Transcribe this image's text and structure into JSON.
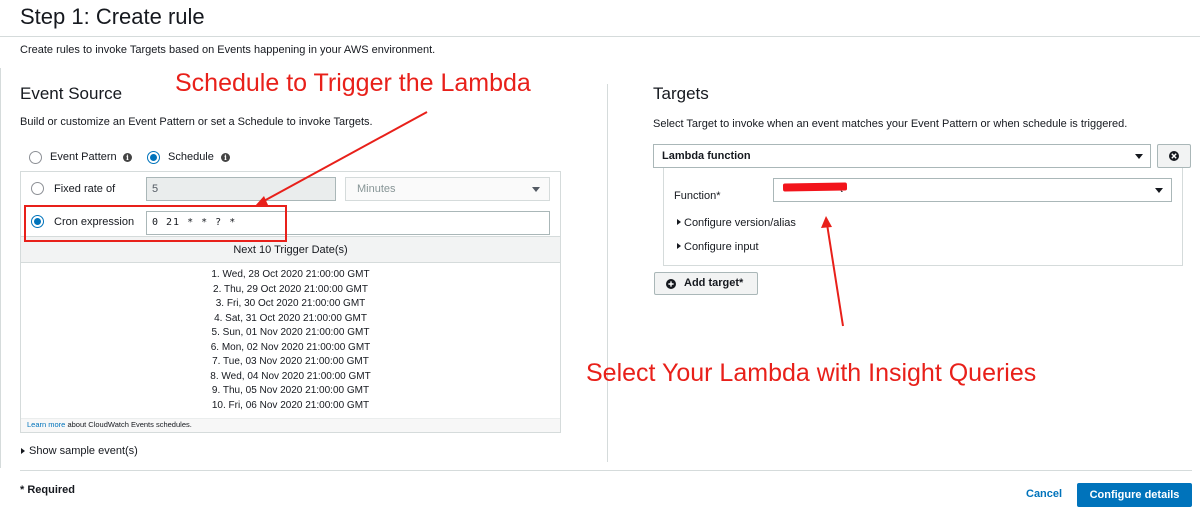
{
  "page": {
    "title": "Step 1: Create rule",
    "subtitle": "Create rules to invoke Targets based on Events happening in your AWS environment."
  },
  "event_source": {
    "heading": "Event Source",
    "help": "Build or customize an Event Pattern or set a Schedule to invoke Targets.",
    "mode_options": [
      {
        "label": "Event Pattern",
        "selected": false
      },
      {
        "label": "Schedule",
        "selected": true
      }
    ],
    "fixed_rate": {
      "label": "Fixed rate of",
      "value": "5",
      "unit": "Minutes",
      "selected": false
    },
    "cron": {
      "label": "Cron expression",
      "value": "0 21 * * ? *",
      "selected": true
    },
    "next_dates_header": "Next 10 Trigger Date(s)",
    "next_dates": [
      "1. Wed, 28 Oct 2020 21:00:00 GMT",
      "2. Thu, 29 Oct 2020 21:00:00 GMT",
      "3. Fri, 30 Oct 2020 21:00:00 GMT",
      "4. Sat, 31 Oct 2020 21:00:00 GMT",
      "5. Sun, 01 Nov 2020 21:00:00 GMT",
      "6. Mon, 02 Nov 2020 21:00:00 GMT",
      "7. Tue, 03 Nov 2020 21:00:00 GMT",
      "8. Wed, 04 Nov 2020 21:00:00 GMT",
      "9. Thu, 05 Nov 2020 21:00:00 GMT",
      "10. Fri, 06 Nov 2020 21:00:00 GMT"
    ],
    "learn_more_link": "Learn more",
    "learn_more_rest": " about CloudWatch Events schedules.",
    "show_sample": "Show sample event(s)"
  },
  "targets": {
    "heading": "Targets",
    "help": "Select Target to invoke when an event matches your Event Pattern or when schedule is triggered.",
    "target_type": "Lambda function",
    "function_label": "Function*",
    "function_value_visible": "t",
    "configure_version": "Configure version/alias",
    "configure_input": "Configure input",
    "add_target": "Add target*"
  },
  "footer": {
    "required_note": "* Required",
    "cancel": "Cancel",
    "configure_details": "Configure details"
  },
  "annotations": {
    "schedule_note": "Schedule to Trigger the Lambda",
    "lambda_note": "Select Your Lambda with Insight Queries"
  },
  "colors": {
    "accent_blue": "#0073bb",
    "annotation_red": "#e8201a",
    "border_gray": "#d5dbdb"
  },
  "icons": {
    "info": "info-icon",
    "remove": "close-icon",
    "add": "plus-circle-icon",
    "expand": "caret-right-icon",
    "dropdown": "chevron-down-icon"
  }
}
